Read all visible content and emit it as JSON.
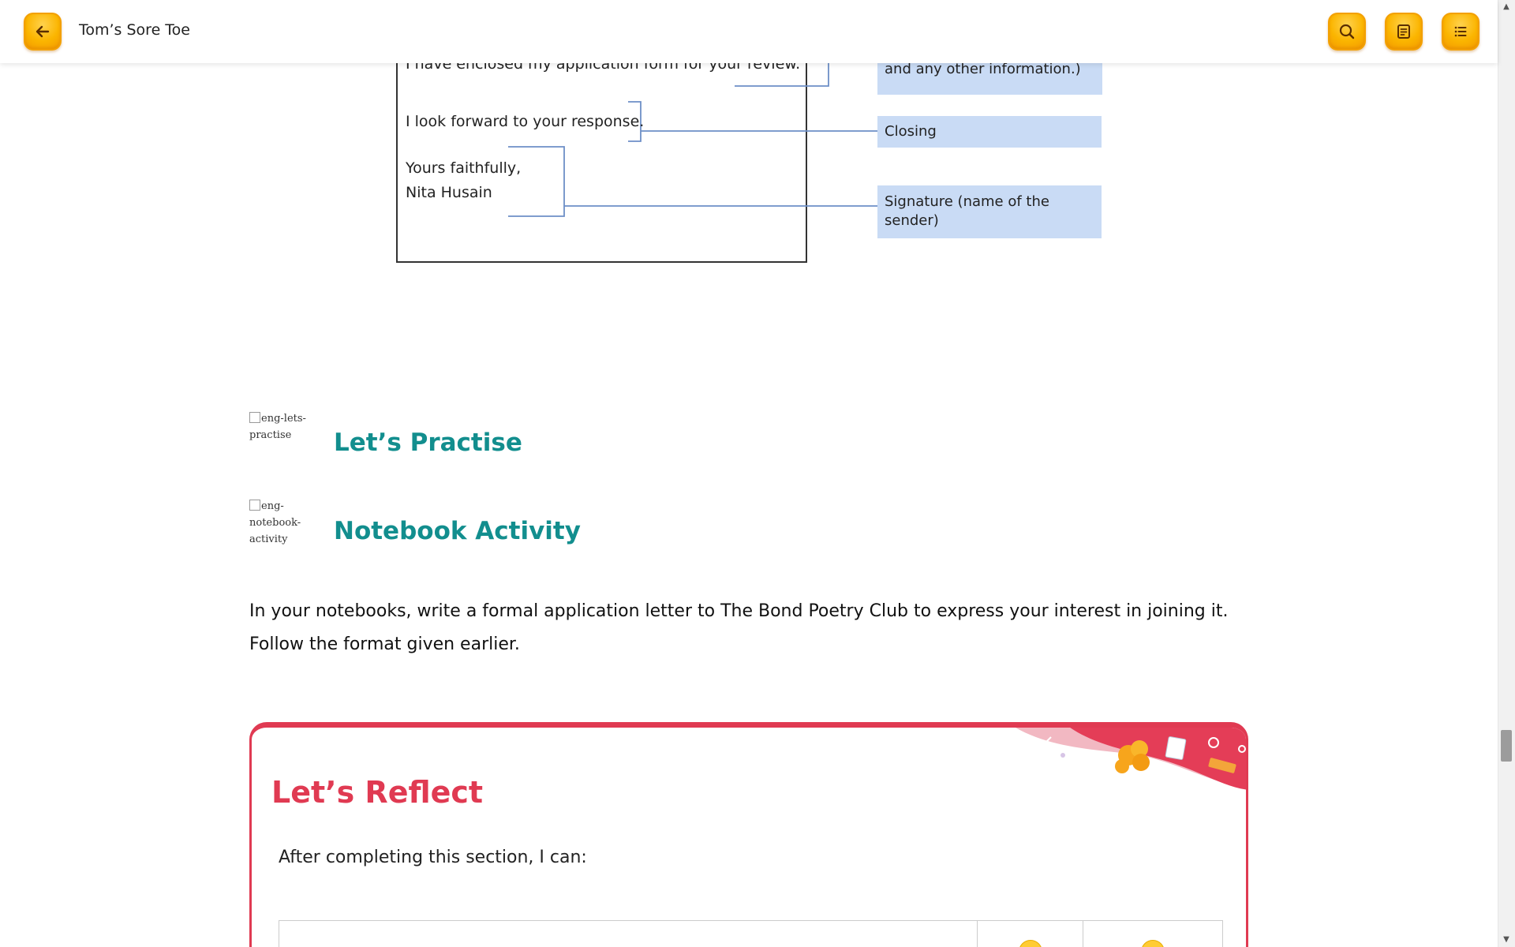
{
  "header": {
    "title": "Tom’s Sore Toe"
  },
  "letter": {
    "line_enclosed": "I have enclosed my application form  for your review.",
    "line_response": "I look forward to your response.",
    "line_yours": "Yours faithfully,",
    "line_name": "Nita Husain"
  },
  "labels": {
    "body_tail": "and any other information.)",
    "closing": "Closing",
    "signature": "Signature (name of the sender)"
  },
  "practise": {
    "image_alt": "eng-lets-practise",
    "heading": "Let’s Practise"
  },
  "notebook": {
    "image_alt": "eng-notebook-activity",
    "heading": "Notebook Activity"
  },
  "instruction": "In your notebooks, write a formal application letter to The Bond Poetry Club to express your interest in joining it. Follow the format given earlier.",
  "reflect": {
    "title": "Let’s Reflect",
    "subtitle": "After completing this section, I can:"
  },
  "colors": {
    "accent_orange": "#fbb500",
    "heading_teal": "#128e8e",
    "reflect_red": "#e03a52",
    "label_blue": "#c9dbf5"
  }
}
